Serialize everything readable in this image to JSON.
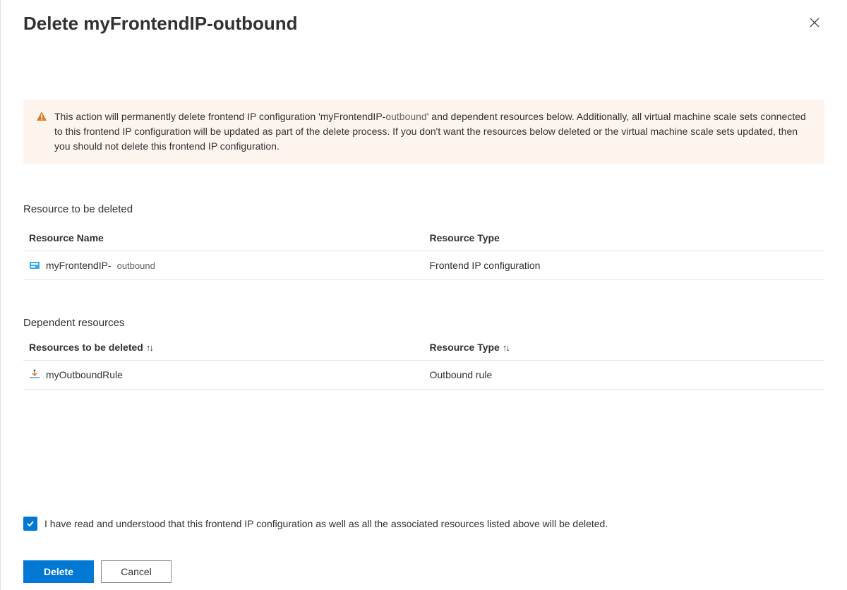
{
  "header": {
    "title_prefix": "Delete myFrontendIP-",
    "title_bold_suffix": "outbound"
  },
  "warning": {
    "text_a": "This action will permanently delete frontend IP configuration 'myFrontendIP-",
    "text_suffix": "outbound",
    "text_b": "' and dependent resources below. Additionally, all virtual machine scale sets connected to this frontend IP configuration will be updated as part of the delete process. If you don't want the resources below deleted or the virtual machine scale sets updated, then you should not delete this frontend IP configuration."
  },
  "section1": {
    "heading": "Resource to be deleted",
    "col1": "Resource Name",
    "col2": "Resource Type",
    "rows": [
      {
        "name_prefix": "myFrontendIP-",
        "name_suffix": "outbound",
        "type": "Frontend IP configuration"
      }
    ]
  },
  "section2": {
    "heading": "Dependent resources",
    "col1": "Resources to be deleted",
    "col2": "Resource Type",
    "rows": [
      {
        "name": "myOutboundRule",
        "type": "Outbound rule"
      }
    ]
  },
  "footer": {
    "confirm": "I have read and understood that this frontend IP configuration as well as all the associated resources listed above will be deleted.",
    "delete": "Delete",
    "cancel": "Cancel"
  }
}
